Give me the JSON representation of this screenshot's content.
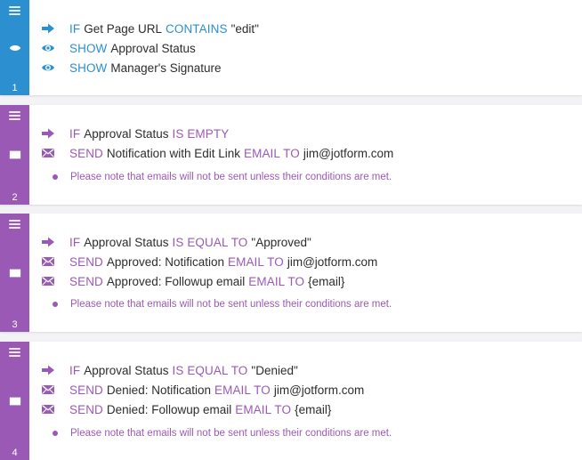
{
  "colors": {
    "blue": "#2b8fd0",
    "purple": "#9b59b6"
  },
  "conditions": [
    {
      "number": "1",
      "icon": "eye-icon",
      "rows": [
        {
          "icon": "arrow-right-icon",
          "kw1": "IF",
          "t1": "Get Page URL",
          "kw2": "CONTAINS",
          "t2": "\"edit\""
        },
        {
          "icon": "eye-icon",
          "kw1": "SHOW",
          "t1": "Approval Status"
        },
        {
          "icon": "eye-icon",
          "kw1": "SHOW",
          "t1": "Manager's Signature"
        }
      ]
    },
    {
      "number": "2",
      "icon": "envelope-icon",
      "rows": [
        {
          "icon": "arrow-right-icon",
          "kw1": "IF",
          "t1": "Approval Status",
          "kw2": "IS EMPTY"
        },
        {
          "icon": "envelope-icon",
          "kw1": "SEND",
          "t1": "Notification with Edit Link",
          "kw2": "EMAIL TO",
          "t2": "jim@jotform.com"
        }
      ],
      "note": "Please note that emails will not be sent unless their conditions are met."
    },
    {
      "number": "3",
      "icon": "envelope-icon",
      "rows": [
        {
          "icon": "arrow-right-icon",
          "kw1": "IF",
          "t1": "Approval Status",
          "kw2": "IS EQUAL TO",
          "t2": "\"Approved\""
        },
        {
          "icon": "envelope-icon",
          "kw1": "SEND",
          "t1": "Approved: Notification",
          "kw2": "EMAIL TO",
          "t2": "jim@jotform.com"
        },
        {
          "icon": "envelope-icon",
          "kw1": "SEND",
          "t1": "Approved: Followup email",
          "kw2": "EMAIL TO",
          "t2": "{email}"
        }
      ],
      "note": "Please note that emails will not be sent unless their conditions are met."
    },
    {
      "number": "4",
      "icon": "envelope-icon",
      "rows": [
        {
          "icon": "arrow-right-icon",
          "kw1": "IF",
          "t1": "Approval Status",
          "kw2": "IS EQUAL TO",
          "t2": "\"Denied\""
        },
        {
          "icon": "envelope-icon",
          "kw1": "SEND",
          "t1": "Denied: Notification",
          "kw2": "EMAIL TO",
          "t2": "jim@jotform.com"
        },
        {
          "icon": "envelope-icon",
          "kw1": "SEND",
          "t1": "Denied: Followup email",
          "kw2": "EMAIL TO",
          "t2": "{email}"
        }
      ],
      "note": "Please note that emails will not be sent unless their conditions are met."
    }
  ]
}
